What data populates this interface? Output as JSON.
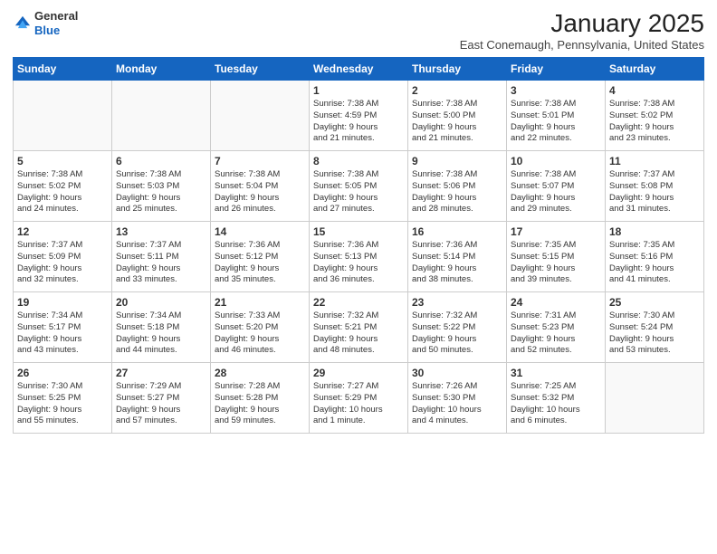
{
  "header": {
    "logo_general": "General",
    "logo_blue": "Blue",
    "month_title": "January 2025",
    "location": "East Conemaugh, Pennsylvania, United States"
  },
  "weekdays": [
    "Sunday",
    "Monday",
    "Tuesday",
    "Wednesday",
    "Thursday",
    "Friday",
    "Saturday"
  ],
  "weeks": [
    [
      {
        "num": "",
        "info": ""
      },
      {
        "num": "",
        "info": ""
      },
      {
        "num": "",
        "info": ""
      },
      {
        "num": "1",
        "info": "Sunrise: 7:38 AM\nSunset: 4:59 PM\nDaylight: 9 hours\nand 21 minutes."
      },
      {
        "num": "2",
        "info": "Sunrise: 7:38 AM\nSunset: 5:00 PM\nDaylight: 9 hours\nand 21 minutes."
      },
      {
        "num": "3",
        "info": "Sunrise: 7:38 AM\nSunset: 5:01 PM\nDaylight: 9 hours\nand 22 minutes."
      },
      {
        "num": "4",
        "info": "Sunrise: 7:38 AM\nSunset: 5:02 PM\nDaylight: 9 hours\nand 23 minutes."
      }
    ],
    [
      {
        "num": "5",
        "info": "Sunrise: 7:38 AM\nSunset: 5:02 PM\nDaylight: 9 hours\nand 24 minutes."
      },
      {
        "num": "6",
        "info": "Sunrise: 7:38 AM\nSunset: 5:03 PM\nDaylight: 9 hours\nand 25 minutes."
      },
      {
        "num": "7",
        "info": "Sunrise: 7:38 AM\nSunset: 5:04 PM\nDaylight: 9 hours\nand 26 minutes."
      },
      {
        "num": "8",
        "info": "Sunrise: 7:38 AM\nSunset: 5:05 PM\nDaylight: 9 hours\nand 27 minutes."
      },
      {
        "num": "9",
        "info": "Sunrise: 7:38 AM\nSunset: 5:06 PM\nDaylight: 9 hours\nand 28 minutes."
      },
      {
        "num": "10",
        "info": "Sunrise: 7:38 AM\nSunset: 5:07 PM\nDaylight: 9 hours\nand 29 minutes."
      },
      {
        "num": "11",
        "info": "Sunrise: 7:37 AM\nSunset: 5:08 PM\nDaylight: 9 hours\nand 31 minutes."
      }
    ],
    [
      {
        "num": "12",
        "info": "Sunrise: 7:37 AM\nSunset: 5:09 PM\nDaylight: 9 hours\nand 32 minutes."
      },
      {
        "num": "13",
        "info": "Sunrise: 7:37 AM\nSunset: 5:11 PM\nDaylight: 9 hours\nand 33 minutes."
      },
      {
        "num": "14",
        "info": "Sunrise: 7:36 AM\nSunset: 5:12 PM\nDaylight: 9 hours\nand 35 minutes."
      },
      {
        "num": "15",
        "info": "Sunrise: 7:36 AM\nSunset: 5:13 PM\nDaylight: 9 hours\nand 36 minutes."
      },
      {
        "num": "16",
        "info": "Sunrise: 7:36 AM\nSunset: 5:14 PM\nDaylight: 9 hours\nand 38 minutes."
      },
      {
        "num": "17",
        "info": "Sunrise: 7:35 AM\nSunset: 5:15 PM\nDaylight: 9 hours\nand 39 minutes."
      },
      {
        "num": "18",
        "info": "Sunrise: 7:35 AM\nSunset: 5:16 PM\nDaylight: 9 hours\nand 41 minutes."
      }
    ],
    [
      {
        "num": "19",
        "info": "Sunrise: 7:34 AM\nSunset: 5:17 PM\nDaylight: 9 hours\nand 43 minutes."
      },
      {
        "num": "20",
        "info": "Sunrise: 7:34 AM\nSunset: 5:18 PM\nDaylight: 9 hours\nand 44 minutes."
      },
      {
        "num": "21",
        "info": "Sunrise: 7:33 AM\nSunset: 5:20 PM\nDaylight: 9 hours\nand 46 minutes."
      },
      {
        "num": "22",
        "info": "Sunrise: 7:32 AM\nSunset: 5:21 PM\nDaylight: 9 hours\nand 48 minutes."
      },
      {
        "num": "23",
        "info": "Sunrise: 7:32 AM\nSunset: 5:22 PM\nDaylight: 9 hours\nand 50 minutes."
      },
      {
        "num": "24",
        "info": "Sunrise: 7:31 AM\nSunset: 5:23 PM\nDaylight: 9 hours\nand 52 minutes."
      },
      {
        "num": "25",
        "info": "Sunrise: 7:30 AM\nSunset: 5:24 PM\nDaylight: 9 hours\nand 53 minutes."
      }
    ],
    [
      {
        "num": "26",
        "info": "Sunrise: 7:30 AM\nSunset: 5:25 PM\nDaylight: 9 hours\nand 55 minutes."
      },
      {
        "num": "27",
        "info": "Sunrise: 7:29 AM\nSunset: 5:27 PM\nDaylight: 9 hours\nand 57 minutes."
      },
      {
        "num": "28",
        "info": "Sunrise: 7:28 AM\nSunset: 5:28 PM\nDaylight: 9 hours\nand 59 minutes."
      },
      {
        "num": "29",
        "info": "Sunrise: 7:27 AM\nSunset: 5:29 PM\nDaylight: 10 hours\nand 1 minute."
      },
      {
        "num": "30",
        "info": "Sunrise: 7:26 AM\nSunset: 5:30 PM\nDaylight: 10 hours\nand 4 minutes."
      },
      {
        "num": "31",
        "info": "Sunrise: 7:25 AM\nSunset: 5:32 PM\nDaylight: 10 hours\nand 6 minutes."
      },
      {
        "num": "",
        "info": ""
      }
    ]
  ]
}
